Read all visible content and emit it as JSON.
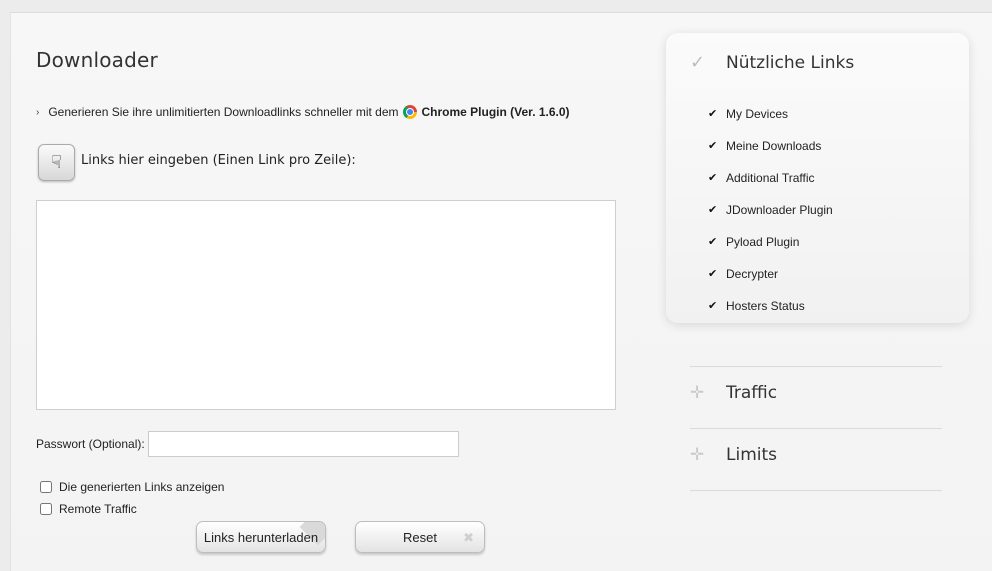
{
  "main": {
    "title": "Downloader",
    "promo_text": "Generieren Sie ihre unlimitierten Downloadlinks schneller mit dem",
    "promo_link": "Chrome Plugin (Ver. 1.6.0)",
    "links_label": "Links hier eingeben (Einen Link pro Zeile):",
    "links_value": "",
    "password_label": "Passwort (Optional):",
    "password_value": "",
    "checkbox_show_links": {
      "label": "Die generierten Links anzeigen",
      "checked": false
    },
    "checkbox_remote_traffic": {
      "label": "Remote Traffic",
      "checked": false
    },
    "download_button": "Links herunterladen",
    "reset_button": "Reset"
  },
  "sidebar": {
    "title": "Nützliche Links",
    "items": [
      {
        "label": "My Devices"
      },
      {
        "label": "Meine Downloads"
      },
      {
        "label": "Additional Traffic"
      },
      {
        "label": "JDownloader Plugin"
      },
      {
        "label": "Pyload Plugin"
      },
      {
        "label": "Decrypter"
      },
      {
        "label": "Hosters Status"
      }
    ],
    "sections": [
      {
        "label": "Traffic"
      },
      {
        "label": "Limits"
      }
    ]
  },
  "icons": {
    "header_check": "check-icon",
    "item_check": "checkmark-icon",
    "section_expand": "plus-icon",
    "pointing_hand": "hand-pointer-icon",
    "chrome": "chrome-icon"
  }
}
